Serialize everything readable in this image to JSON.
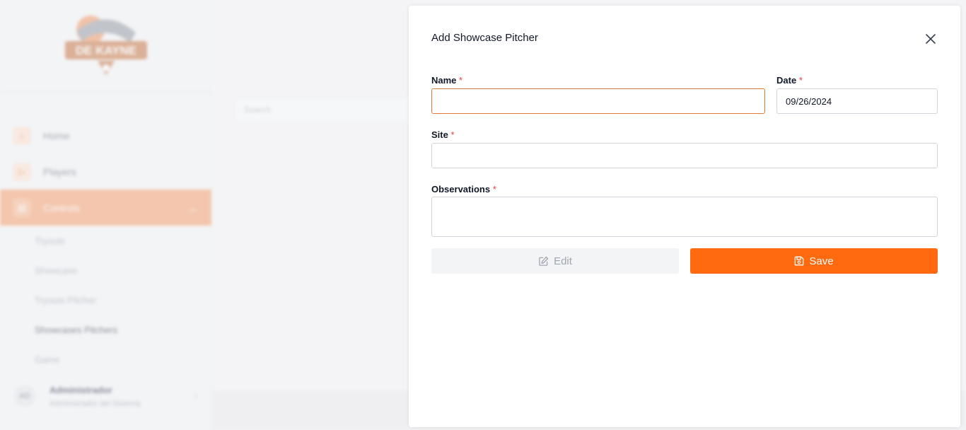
{
  "sidebar": {
    "logo_text": "DE KAYNE",
    "nav": [
      {
        "label": "Home",
        "icon": "home-icon"
      },
      {
        "label": "Players",
        "icon": "play-icon"
      },
      {
        "label": "Controls",
        "icon": "clipboard-icon",
        "active": true
      }
    ],
    "sub_items": [
      "Tryouts",
      "Showcase",
      "Tryouts Pitcher",
      "Showcases Pitchers",
      "Game"
    ],
    "user": {
      "initials": "AD",
      "name": "Administrador",
      "role": "Administrador del Sistema"
    }
  },
  "main": {
    "search_placeholder": "Search"
  },
  "modal": {
    "title": "Add Showcase Pitcher",
    "name": {
      "label": "Name",
      "required": "*",
      "value": ""
    },
    "date": {
      "label": "Date",
      "required": "*",
      "value": "09/26/2024"
    },
    "site": {
      "label": "Site",
      "required": "*",
      "value": ""
    },
    "observations": {
      "label": "Observations",
      "required": "*",
      "value": ""
    },
    "edit_label": "Edit",
    "save_label": "Save"
  },
  "colors": {
    "accent": "#ff6a10",
    "focus_border": "#e07a3b",
    "required": "#e53e3e",
    "sidebar_active": "#f4a273"
  }
}
